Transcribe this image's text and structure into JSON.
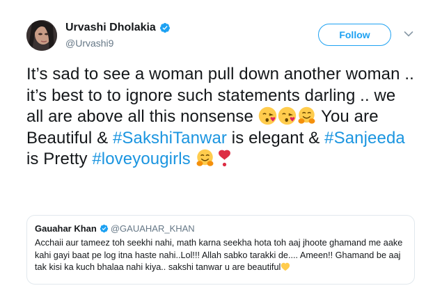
{
  "author": {
    "name": "Urvashi Dholakia",
    "handle": "@Urvashi9"
  },
  "actions": {
    "follow_label": "Follow"
  },
  "tweet": {
    "t1": "It’s sad to see a woman pull down another woman .. it’s best to to ignore such statements darling .. we all are above all this nonsense ",
    "t2": " You are Beautiful & ",
    "tag1": "#SakshiTanwar",
    "t3": " is elegant & ",
    "tag2": "#Sanjeeda",
    "t4": " is Pretty ",
    "tag3": "#loveyougirls",
    "emojis": [
      "kissing-heart-emoji",
      "kissing-heart-emoji",
      "hugging-face-emoji",
      "hugging-face-emoji",
      "red-heart-exclamation-emoji"
    ]
  },
  "quote": {
    "name": "Gauahar Khan",
    "handle": "@GAUAHAR_KHAN",
    "text": "Acchaii aur tameez toh seekhi nahi, math karna seekha hota toh aaj jhoote ghamand me aake kahi gayi baat pe log itna haste nahi..Lol!!! Allah sabko tarakki de.... Ameen!! Ghamand be aaj tak kisi ka kuch bhalaa nahi kiya.. sakshi tanwar u are beautiful"
  },
  "colors": {
    "accent": "#1da1f2",
    "hashtag": "#1b95e0",
    "secondary_text": "#657786",
    "border": "#e1e8ed"
  }
}
